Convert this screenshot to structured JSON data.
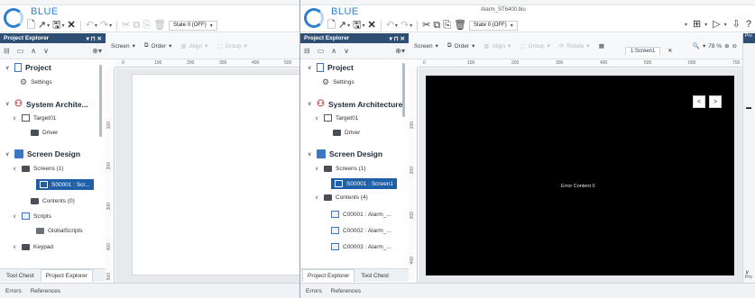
{
  "win1": {
    "brand": "BLUE",
    "state_select": "State 0 (OFF)",
    "panel_title": "Project Explorer",
    "panel_title_pin": "▾ ⊓ ✕",
    "tree": {
      "project": "Project",
      "settings": "Settings",
      "system_arch": "System Archite...",
      "target": "Target01",
      "driver": "Driver",
      "screen_design": "Screen Design",
      "screens": "Screens (1)",
      "screen_item": "S00001 : Scr...",
      "contents": "Contents (0)",
      "scripts": "Scripts",
      "global_scripts": "GlobalScripts",
      "keypad": "Keypad"
    },
    "canvas_toolbar": {
      "screen": "Screen",
      "order": "Order",
      "align": "Align",
      "group": "Group"
    },
    "ruler_h": [
      "0",
      "100",
      "200",
      "300",
      "400",
      "500"
    ],
    "ruler_v": [
      "100",
      "200",
      "300",
      "400",
      "500"
    ],
    "bottom_tabs": [
      "Tool Chest",
      "Project Explorer"
    ],
    "status_tabs": [
      "Errors",
      "References"
    ]
  },
  "win2": {
    "brand": "BLUE",
    "filename": "Alarm_ST6400.blu",
    "state_select": "State 0 (OFF)",
    "panel_title": "Project Explorer",
    "panel_title_pin": "▾ ⊓ ✕",
    "tree": {
      "project": "Project",
      "settings": "Settings",
      "system_arch": "System Architecture",
      "target": "Target01",
      "driver": "Driver",
      "screen_design": "Screen Design",
      "screens": "Screens (1)",
      "screen_item": "S00001 : Screen1",
      "contents": "Contents (4)",
      "c1": "C00001 : Alarm_...",
      "c2": "C00002 : Alarm_...",
      "c3": "C00003 : Alarm_..."
    },
    "canvas_toolbar": {
      "screen": "Screen",
      "order": "Order",
      "align": "Align",
      "group": "Group",
      "rotate": "Rotate",
      "zoom": "78 %"
    },
    "doc_tab": "1:Screen1",
    "side_strip": "Pro",
    "side_bottom": "Pro",
    "ruler_h": [
      "0",
      "100",
      "200",
      "300",
      "400",
      "500",
      "600",
      "700"
    ],
    "ruler_v": [
      "100",
      "200",
      "300",
      "400"
    ],
    "error_text": "Error Content 0",
    "nav_prev": "<",
    "nav_next": ">",
    "bottom_tabs": [
      "Project Explorer",
      "Tool Chest"
    ],
    "status_tabs": [
      "Errors",
      "References"
    ]
  },
  "icons": [
    "new-file-icon",
    "open-icon",
    "save-icon",
    "close-x-icon",
    "undo-icon",
    "redo-icon",
    "copy-icon",
    "paste-icon",
    "delete-icon",
    "order-icon",
    "zoom-icon",
    "play-icon"
  ],
  "colors": {
    "accent": "#2f7fd1",
    "panel_head": "#2e4e73",
    "selection": "#1f5fa8"
  }
}
